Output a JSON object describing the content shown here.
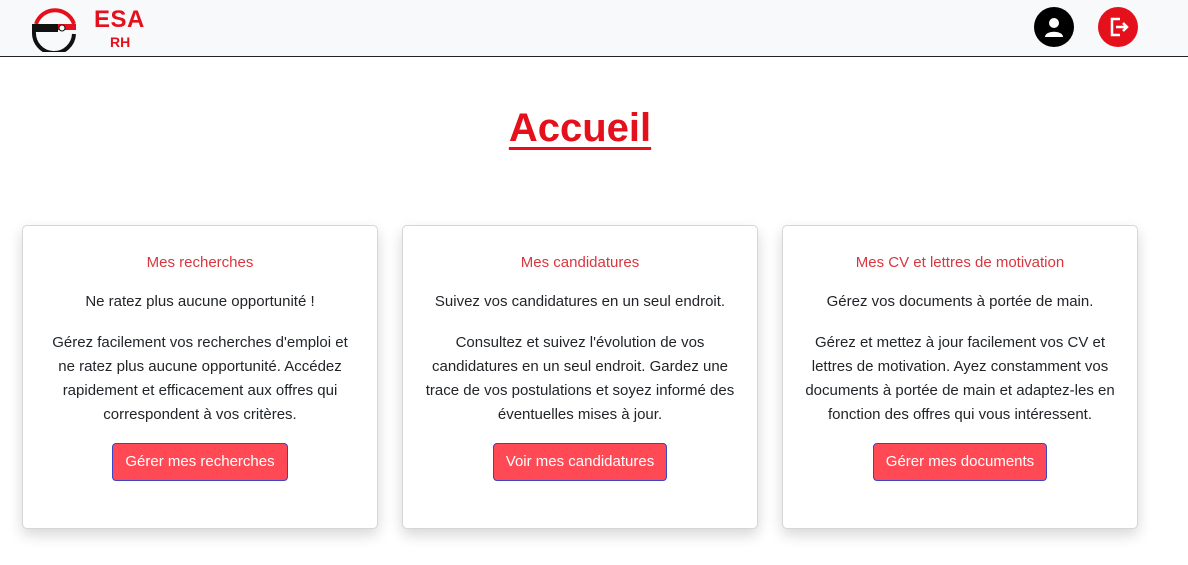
{
  "brand": {
    "title": "ESA",
    "subtitle": "RH",
    "accent": "#e4101c"
  },
  "header": {
    "profile_icon": "user-icon",
    "logout_icon": "logout-icon"
  },
  "page": {
    "title": "Accueil"
  },
  "cards": [
    {
      "title": "Mes recherches",
      "tagline": "Ne ratez plus aucune opportunité !",
      "description": "Gérez facilement vos recherches d'emploi et ne ratez plus aucune opportunité. Accédez rapidement et efficacement aux offres qui correspondent à vos critères.",
      "button": "Gérer mes recherches"
    },
    {
      "title": "Mes candidatures",
      "tagline": "Suivez vos candidatures en un seul endroit.",
      "description": "Consultez et suivez l'évolution de vos candidatures en un seul endroit. Gardez une trace de vos postulations et soyez informé des éventuelles mises à jour.",
      "button": "Voir mes candidatures"
    },
    {
      "title": "Mes CV et lettres de motivation",
      "tagline": "Gérez vos documents à portée de main.",
      "description": "Gérez et mettez à jour facilement vos CV et lettres de motivation. Ayez constamment vos documents à portée de main et adaptez-les en fonction des offres qui vous intéressent.",
      "button": "Gérer mes documents"
    }
  ],
  "colors": {
    "card_title": "#d9363e",
    "button_bg": "#ff4a55",
    "button_border": "#3a46c8"
  }
}
